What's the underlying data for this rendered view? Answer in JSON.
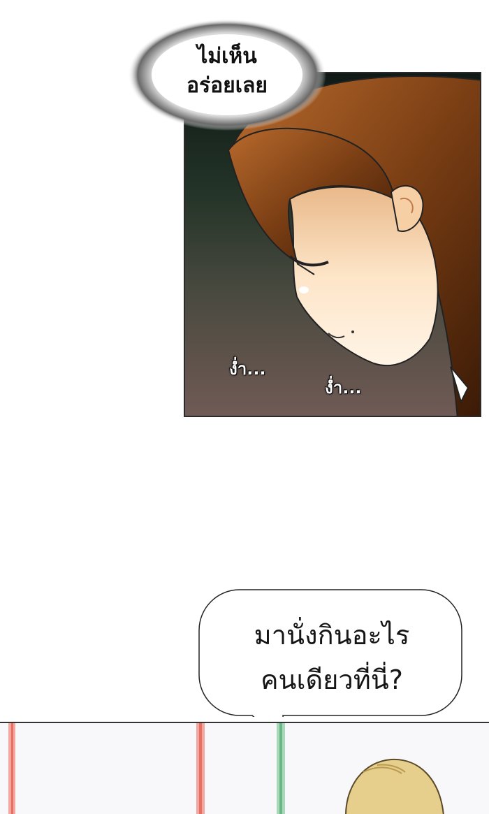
{
  "panel_1": {
    "thought": {
      "line_1": "ไม่เห็น",
      "line_2": "อร่อยเลย"
    },
    "sfx": [
      "ง่ำ...",
      "ง่ำ..."
    ]
  },
  "panel_2": {
    "speech": {
      "line_1": "มานั่งกินอะไร",
      "line_2": "คนเดียวที่นี่?"
    }
  },
  "colors": {
    "hair": "#8a4a1e",
    "skin": "#fde5c8",
    "pole_red": "#f08a80",
    "pole_green": "#7fc79a",
    "blonde_hair": "#e6cf8c"
  }
}
